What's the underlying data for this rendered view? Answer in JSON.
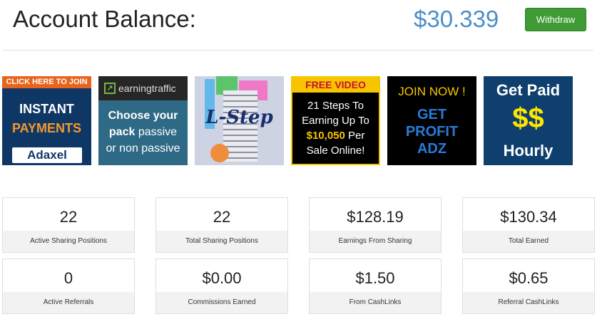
{
  "header": {
    "title": "Account Balance:",
    "balance": "$30.339",
    "withdraw_label": "Withdraw"
  },
  "banners": {
    "adaxel": {
      "top": "CLICK HERE TO JOIN",
      "line1": "INSTANT",
      "line2": "PAYMENTS",
      "logo": "Adaxel"
    },
    "earningtraffic": {
      "brand": "earningtraffic",
      "line1": "Choose your",
      "line2_bold": "pack",
      "line2_rest": " passive",
      "line3": "or non passive"
    },
    "lstep": {
      "text": "L-Step"
    },
    "freevideo": {
      "top": "FREE VIDEO",
      "l1": "21 Steps To",
      "l2": "Earning Up To",
      "l3_amount": "$10,050",
      "l3_rest": " Per",
      "l4": "Sale Online!"
    },
    "profitadz": {
      "l1": "JOIN NOW !",
      "l2": "GET",
      "l3": "PROFIT",
      "l4": "ADZ"
    },
    "getpaid": {
      "l1": "Get Paid",
      "l2": "$$",
      "l3": "Hourly"
    }
  },
  "stats": [
    {
      "value": "22",
      "label": "Active Sharing Positions"
    },
    {
      "value": "22",
      "label": "Total Sharing Positions"
    },
    {
      "value": "$128.19",
      "label": "Earnings From Sharing"
    },
    {
      "value": "$130.34",
      "label": "Total Earned"
    },
    {
      "value": "0",
      "label": "Active Referrals"
    },
    {
      "value": "$0.00",
      "label": "Commissions Earned"
    },
    {
      "value": "$1.50",
      "label": "From CashLinks"
    },
    {
      "value": "$0.65",
      "label": "Referral CashLinks"
    }
  ],
  "colors": {
    "balance": "#4a8ec9",
    "withdraw_button": "#3f9c35"
  }
}
